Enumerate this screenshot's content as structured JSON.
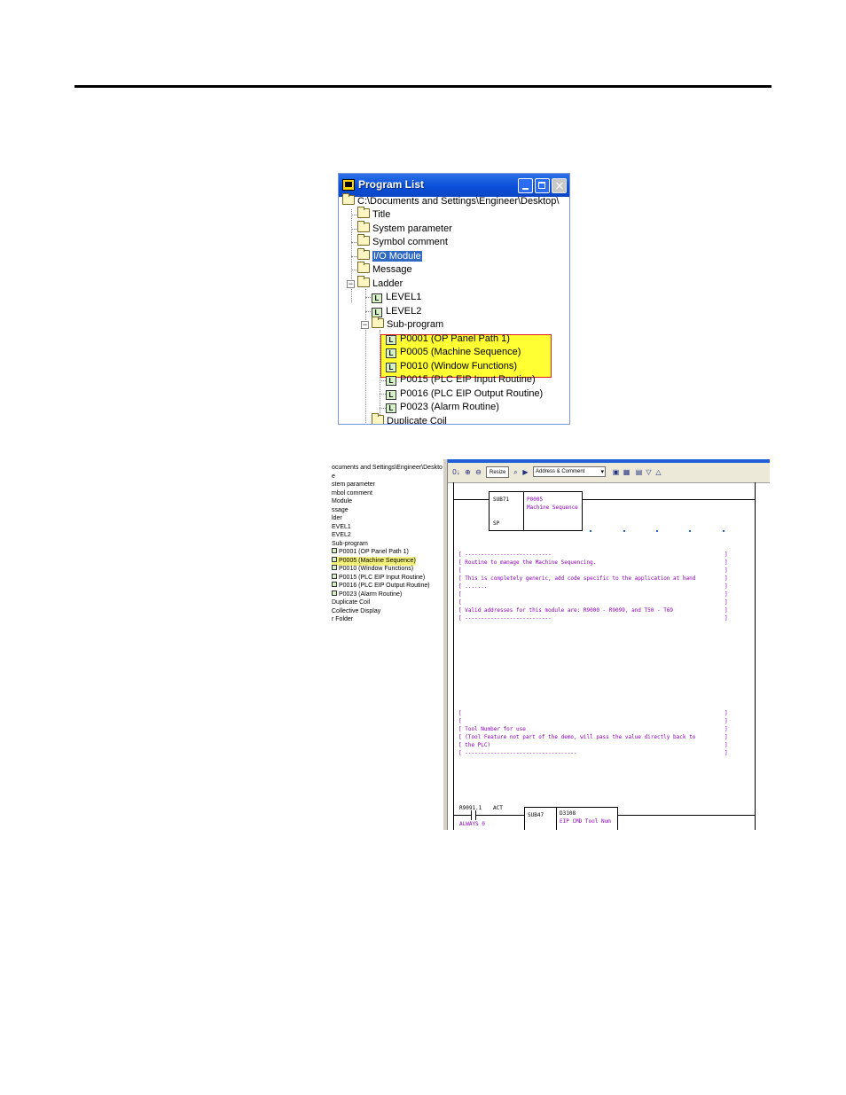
{
  "window": {
    "title": "Program List",
    "tree": {
      "root": "C:\\Documents and Settings\\Engineer\\Desktop\\",
      "items": [
        "Title",
        "System parameter",
        "Symbol comment",
        "I/O Module",
        "Message",
        "Ladder"
      ],
      "ladder_items": [
        "LEVEL1",
        "LEVEL2",
        "Sub-program"
      ],
      "subprograms": [
        "P0001 (OP Panel Path 1)",
        "P0005 (Machine Sequence)",
        "P0010 (Window Functions)",
        "P0015 (PLC EIP Input Routine)",
        "P0016 (PLC EIP Output Routine)",
        "P0023 (Alarm Routine)"
      ],
      "partial_item": "Duplicate Coil"
    },
    "selected_item": "I/O Module",
    "highlight_color": "#ffff33"
  },
  "snap2": {
    "left_tree": [
      "ocuments and Settings\\Engineer\\Desktop\\",
      "e",
      "stem parameter",
      "mbol comment",
      "Module",
      "ssage",
      "lder",
      "EVEL1",
      "EVEL2",
      "Sub-program",
      "P0001 (OP Panel Path 1)",
      "P0005 (Machine Sequence)",
      "P0010 (Window Functions)",
      "P0015 (PLC EIP Input Routine)",
      "P0016 (PLC EIP Output Routine)",
      "P0023 (Alarm Routine)",
      "Duplicate Coil",
      "Collective Display",
      "r Folder"
    ],
    "toolbar": {
      "resize_label": "Resize",
      "view_select": "Address & Comment"
    },
    "block1": {
      "name": "SUB71",
      "addr": "P0005",
      "desc": "Machine Sequence",
      "sp": "SP"
    },
    "comments1": [
      "[ ---------------------------",
      "[ Routine to manage the Machine Sequencing.",
      "[",
      "[ This is completely generic, add code specific to the application at hand",
      "[ .......",
      "[",
      "[",
      "[ Valid addresses for this module are: R9000 - R9099, and T50 - T69",
      "[ ---------------------------"
    ],
    "comments2": [
      "[",
      "[",
      "[ Tool Number for use",
      "[ (Tool Feature not part of the demo, will pass the value directly back to",
      "[   the PLC)",
      "[ -----------------------------------"
    ],
    "bottom": {
      "contact_addr": "R9091.1",
      "contact_act": "ACT",
      "contact_label": "ALWAYS 0",
      "block_name": "SUB47",
      "out_addr": "D3108",
      "out_desc": "EIP CMD Tool Num"
    }
  }
}
